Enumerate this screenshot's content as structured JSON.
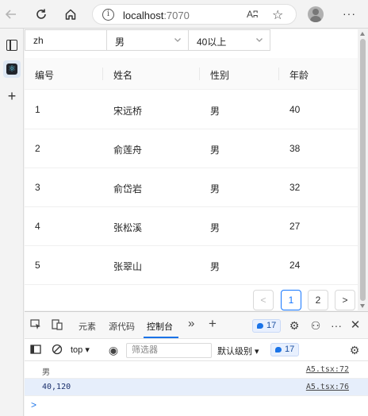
{
  "browser": {
    "url_host": "localhost",
    "url_port": ":7070",
    "read_aloud": "Aʭ"
  },
  "filters": {
    "name_value": "zh",
    "gender_value": "男",
    "age_value": "40以上"
  },
  "table": {
    "headers": [
      "编号",
      "姓名",
      "性别",
      "年龄"
    ],
    "rows": [
      [
        "1",
        "宋远桥",
        "男",
        "40"
      ],
      [
        "2",
        "俞莲舟",
        "男",
        "38"
      ],
      [
        "3",
        "俞岱岩",
        "男",
        "32"
      ],
      [
        "4",
        "张松溪",
        "男",
        "27"
      ],
      [
        "5",
        "张翠山",
        "男",
        "24"
      ]
    ]
  },
  "pagination": {
    "prev": "<",
    "pages": [
      "1",
      "2"
    ],
    "next": ">",
    "current": "1"
  },
  "devtools": {
    "tabs": [
      "元素",
      "源代码",
      "控制台"
    ],
    "active_tab": "控制台",
    "more_tabs": "»",
    "issues_count": "17",
    "context": "top",
    "filter_placeholder": "筛选器",
    "level": "默认级别",
    "level_count": "17",
    "logs": [
      {
        "text": "男",
        "source": "A5.tsx:72"
      },
      {
        "text": "40,120",
        "source": "A5.tsx:76"
      }
    ],
    "prompt": ">"
  },
  "colors": {
    "primary": "#1677ff",
    "devtools_accent": "#1a73e8"
  }
}
